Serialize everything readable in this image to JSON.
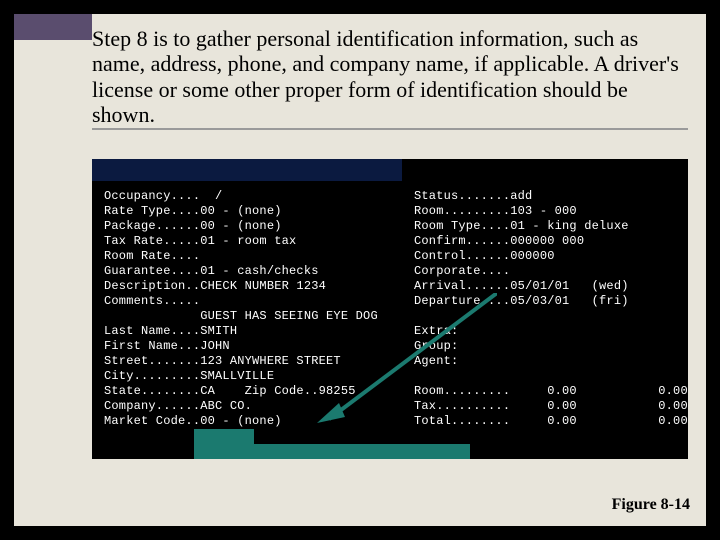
{
  "caption": "Step 8 is to gather personal identification information, such as name, address, phone, and company name, if applicable.  A driver's license or some other proper form of identification should be shown.",
  "figure_label": "Figure 8-14",
  "left_text": "Occupancy....  /\nRate Type....00 - (none)\nPackage......00 - (none)\nTax Rate.....01 - room tax\nRoom Rate....\nGuarantee....01 - cash/checks\nDescription..CHECK NUMBER 1234\nComments.....\n             GUEST HAS SEEING EYE DOG\nLast Name....SMITH\nFirst Name...JOHN\nStreet.......123 ANYWHERE STREET\nCity.........SMALLVILLE\nState........CA    Zip Code..98255\nCompany......ABC CO.\nMarket Code..00 - (none)",
  "right_text": "Status.......add\nRoom.........103 - 000\nRoom Type....01 - king deluxe\nConfirm......000000 000\nControl......000000\nCorporate....\nArrival......05/01/01   (wed)\nDeparture....05/03/01   (fri)\n\nExtra:\nGroup:\nAgent:\n\nRoom.........     0.00           0.00\nTax..........     0.00           0.00\nTotal........     0.00           0.00"
}
